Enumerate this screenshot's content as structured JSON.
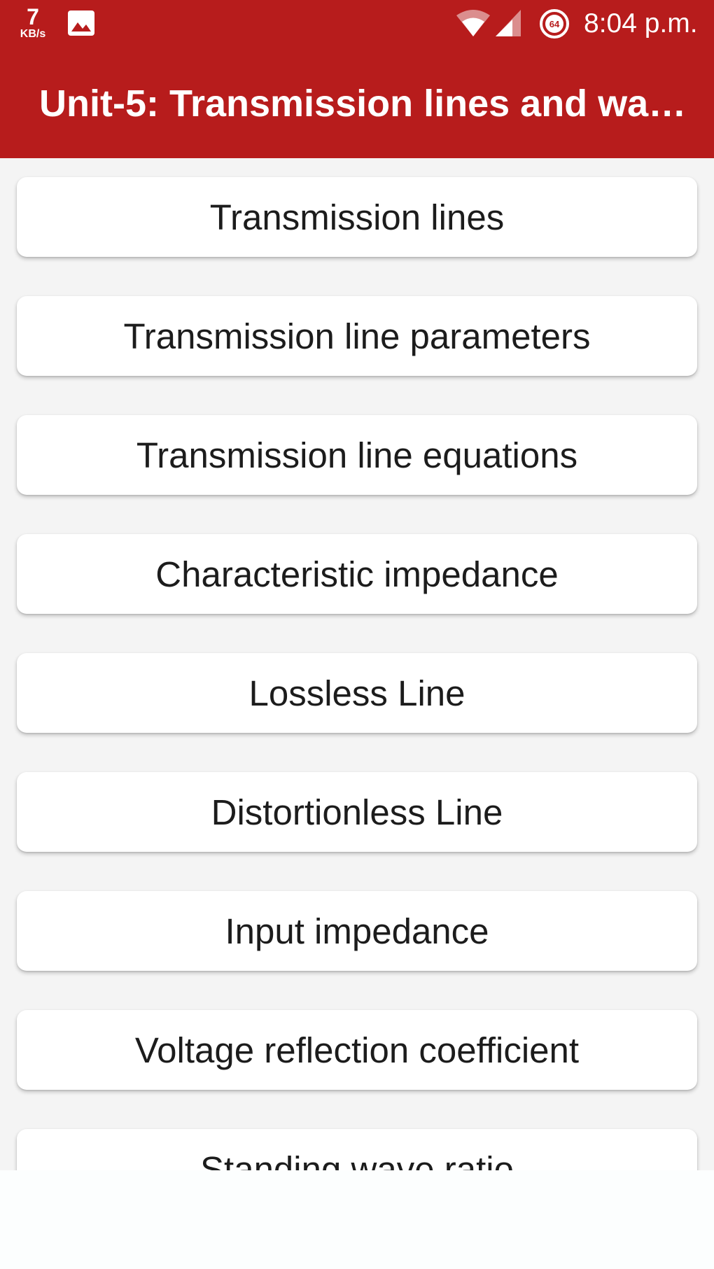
{
  "status_bar": {
    "network_speed_value": "7",
    "network_speed_unit": "KB/s",
    "battery_level": "64",
    "time": "8:04 p.m."
  },
  "app_bar": {
    "title": "Unit-5: Transmission lines and wav..."
  },
  "topics": [
    {
      "label": "Transmission lines"
    },
    {
      "label": "Transmission line parameters"
    },
    {
      "label": "Transmission line equations"
    },
    {
      "label": "Characteristic impedance"
    },
    {
      "label": "Lossless Line"
    },
    {
      "label": "Distortionless Line"
    },
    {
      "label": "Input impedance"
    },
    {
      "label": "Voltage reflection coefficient"
    },
    {
      "label": "Standing wave ratio"
    }
  ],
  "colors": {
    "app_bar": "#b71c1c",
    "list_background": "#f4f4f4",
    "card": "#ffffff",
    "card_text": "#1c1c1c"
  },
  "icons": [
    "image-icon",
    "wifi-icon",
    "signal-icon",
    "battery-saver-icon"
  ]
}
